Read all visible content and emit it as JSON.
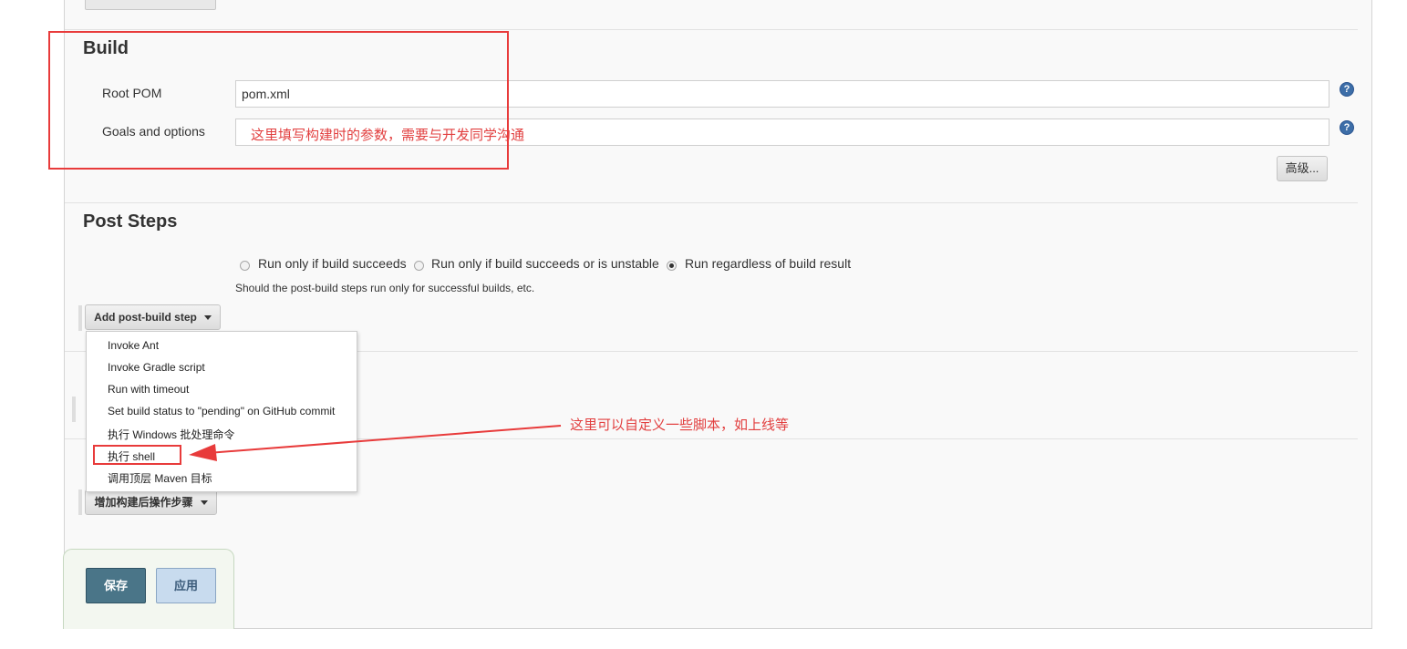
{
  "build": {
    "title": "Build",
    "root_pom_label": "Root POM",
    "root_pom_value": "pom.xml",
    "goals_label": "Goals and options",
    "goals_value": "这里填写构建时的参数，需要与开发同学沟通",
    "advanced_label": "高级...",
    "help_glyph": "?"
  },
  "post_steps": {
    "title": "Post Steps",
    "radio_options": [
      {
        "label": "Run only if build succeeds",
        "checked": false
      },
      {
        "label": "Run only if build succeeds or is unstable",
        "checked": false
      },
      {
        "label": "Run regardless of build result",
        "checked": true
      }
    ],
    "hint": "Should the post-build steps run only for successful builds, etc.",
    "add_button_label": "Add post-build step"
  },
  "dropdown": {
    "items": [
      "Invoke Ant",
      "Invoke Gradle script",
      "Run with timeout",
      "Set build status to \"pending\" on GitHub commit",
      "执行 Windows 批处理命令",
      "执行 shell",
      "调用顶层 Maven 目标"
    ]
  },
  "post_build": {
    "add_button_label": "增加构建后操作步骤"
  },
  "annotation": {
    "text": "这里可以自定义一些脚本，如上线等",
    "color": "#e24040"
  },
  "footer": {
    "save_label": "保存",
    "apply_label": "应用"
  }
}
